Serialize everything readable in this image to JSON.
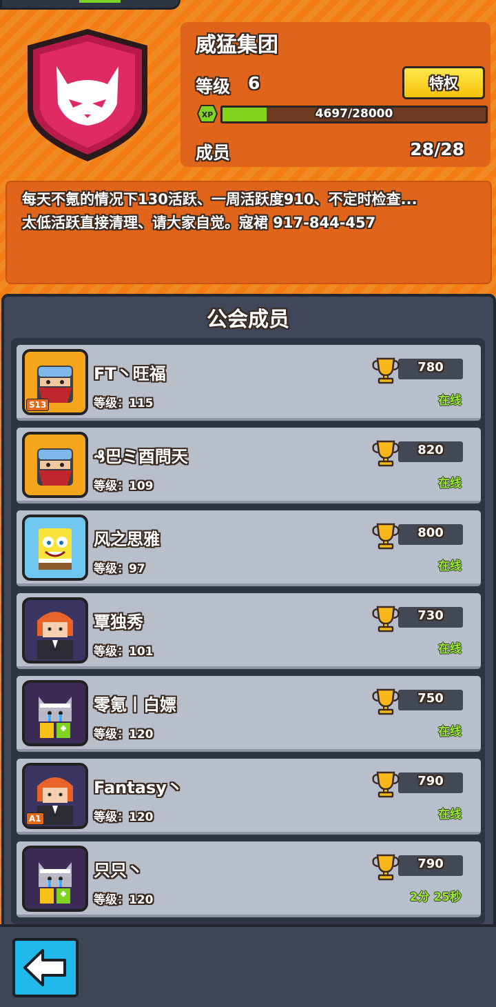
{
  "guild": {
    "name": "威猛集团",
    "level_label": "等级",
    "level": "6",
    "perk_button": "特权",
    "xp_icon": "XP",
    "xp_text": "4697/28000",
    "xp_progress": 0.168,
    "members_label": "成员",
    "members_count": "28/28",
    "emblem_icon": "cat-face-icon"
  },
  "description": {
    "line1": "每天不氪的情况下130活跃、一周活跃度910、不定时检查...",
    "line2": "太低活跃直接清理、请大家自觉。寇裙 917-844-457"
  },
  "members_panel": {
    "title": "公会成员",
    "members": [
      {
        "name": "FT丶旺福",
        "level": "等级：115",
        "trophies": "780",
        "status": "在线",
        "badge": "S13",
        "avatar_icon": "masked-bandit-avatar-icon"
      },
      {
        "name": "₰巴ミ酉問天",
        "level": "等级：109",
        "trophies": "820",
        "status": "在线",
        "badge": "",
        "avatar_icon": "masked-bandit-avatar-icon"
      },
      {
        "name": "风之思雅",
        "level": "等级：97",
        "trophies": "800",
        "status": "在线",
        "badge": "",
        "avatar_icon": "sponge-avatar-icon"
      },
      {
        "name": "覃独秀",
        "level": "等级：101",
        "trophies": "730",
        "status": "在线",
        "badge": "",
        "avatar_icon": "red-hair-avatar-icon"
      },
      {
        "name": "零氪丨白嫖",
        "level": "等级：120",
        "trophies": "750",
        "status": "在线",
        "badge": "",
        "avatar_icon": "crying-cat-avatar-icon"
      },
      {
        "name": "Fantasy丶",
        "level": "等级：120",
        "trophies": "790",
        "status": "在线",
        "badge": "A1",
        "avatar_icon": "red-hair-avatar-icon"
      },
      {
        "name": "只只丶",
        "level": "等级：120",
        "trophies": "790",
        "status": "2分 25秒",
        "badge": "",
        "avatar_icon": "crying-cat-avatar-icon"
      }
    ]
  },
  "colors": {
    "background": "#f37c14",
    "panel": "#3f4758",
    "row": "#b8bfcb",
    "online": "#9ee83a",
    "xp_fill": "#84d41e",
    "back_button": "#21b8ec",
    "emblem": "#d8215a"
  },
  "back_button_icon": "back-arrow-icon"
}
